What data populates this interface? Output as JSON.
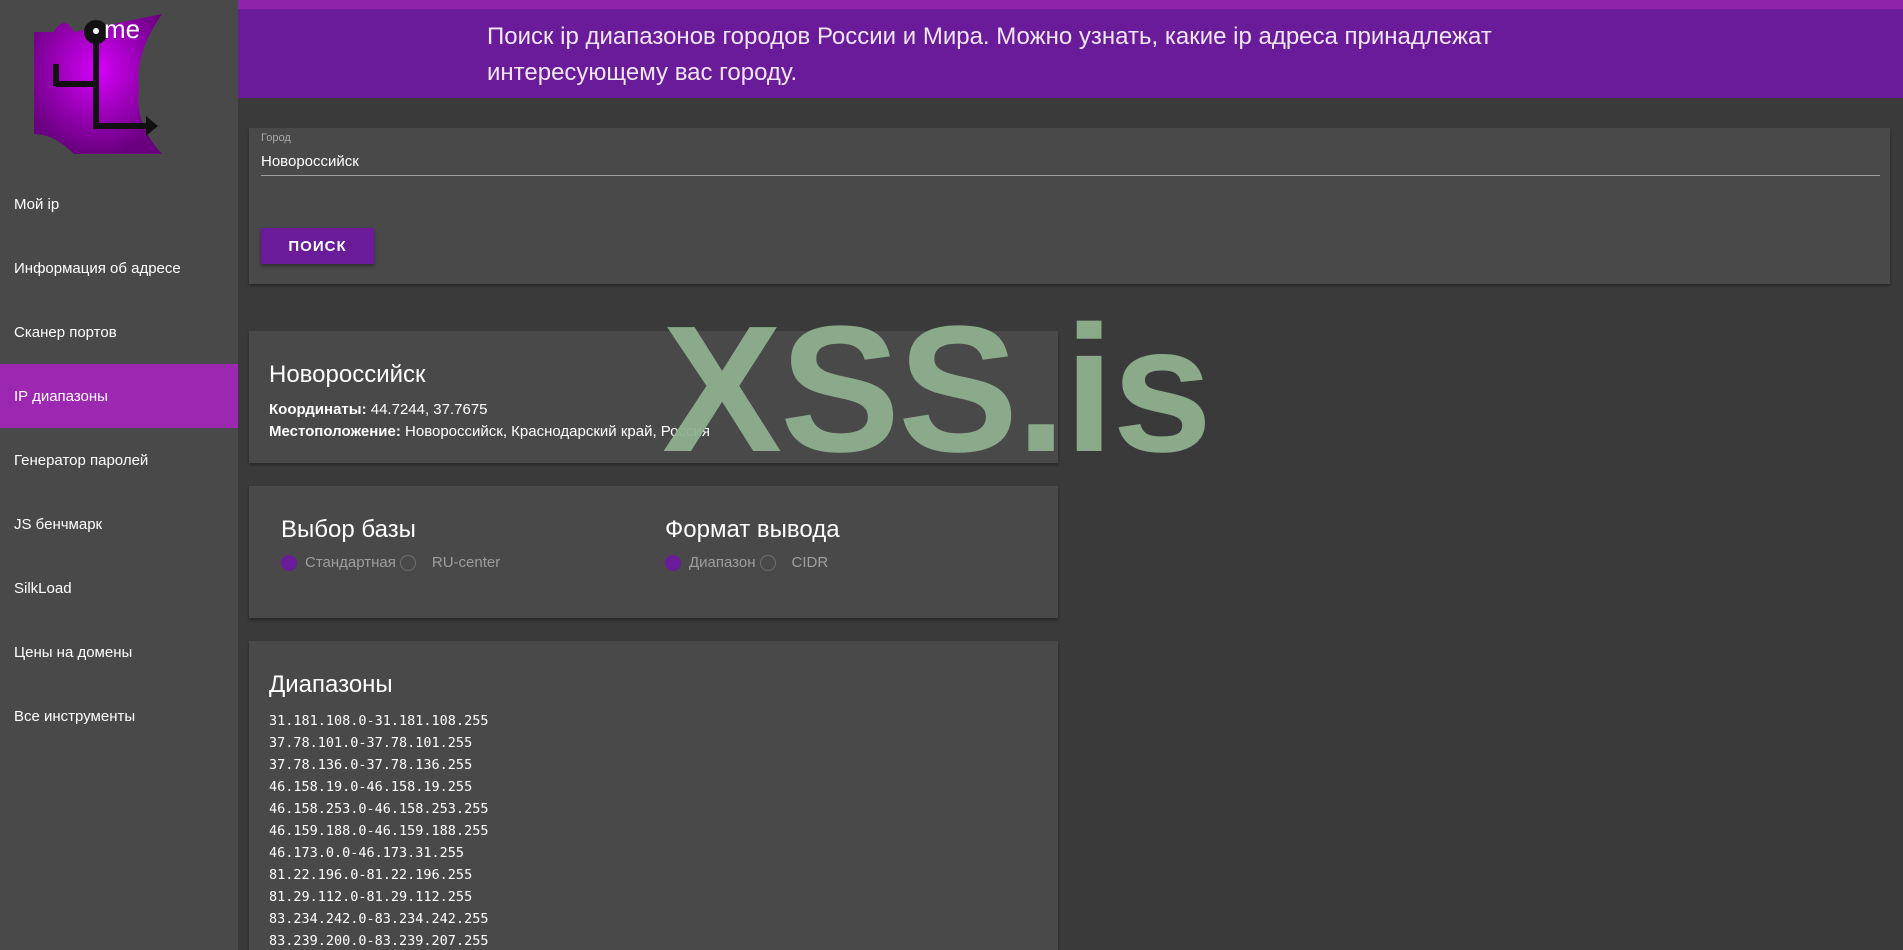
{
  "header": {
    "text": "Поиск ip диапазонов городов России и Мира. Можно узнать, какие ip адреса принадлежат интересующему вас городу."
  },
  "logo": {
    "text": "me"
  },
  "sidebar": {
    "items": [
      {
        "label": "Мой ip"
      },
      {
        "label": "Информация об адресе"
      },
      {
        "label": "Сканер портов"
      },
      {
        "label": "IP диапазоны"
      },
      {
        "label": "Генератор паролей"
      },
      {
        "label": "JS бенчмарк"
      },
      {
        "label": "SilkLoad"
      },
      {
        "label": "Цены на домены"
      },
      {
        "label": "Все инструменты"
      }
    ],
    "active_index": 3
  },
  "search": {
    "label": "Город",
    "value": "Новороссийск",
    "button": "ПОИСК"
  },
  "city": {
    "name": "Новороссийск",
    "coords_label": "Координаты:",
    "coords_value": "44.7244, 37.7675",
    "location_label": "Местоположение:",
    "location_value": "Новороссийск, Краснодарский край, Россия"
  },
  "options": {
    "db_title": "Выбор базы",
    "db_options": [
      {
        "label": "Стандартная",
        "selected": true
      },
      {
        "label": "RU-center",
        "selected": false
      }
    ],
    "format_title": "Формат вывода",
    "format_options": [
      {
        "label": "Диапазон",
        "selected": true
      },
      {
        "label": "CIDR",
        "selected": false
      }
    ]
  },
  "ranges": {
    "title": "Диапазоны",
    "items": [
      "31.181.108.0-31.181.108.255",
      "37.78.101.0-37.78.101.255",
      "37.78.136.0-37.78.136.255",
      "46.158.19.0-46.158.19.255",
      "46.158.253.0-46.158.253.255",
      "46.159.188.0-46.159.188.255",
      "46.173.0.0-46.173.31.255",
      "81.22.196.0-81.22.196.255",
      "81.29.112.0-81.29.112.255",
      "83.234.242.0-83.234.242.255",
      "83.239.200.0-83.239.207.255"
    ]
  },
  "watermark": {
    "text": "XSS.is"
  },
  "colors": {
    "accent": "#6a1b9a",
    "active_nav": "#9c27b0",
    "background": "#3b3a3b",
    "card": "#4a494a",
    "watermark": "#8fb08f"
  }
}
